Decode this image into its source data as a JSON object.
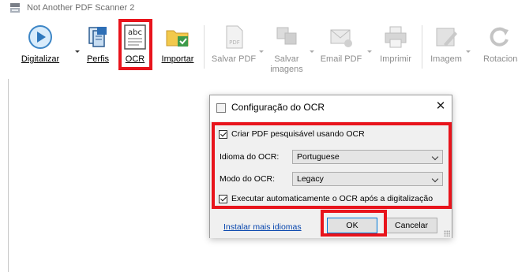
{
  "window": {
    "title": "Not Another PDF Scanner 2",
    "icon": "scanner-app-icon"
  },
  "toolbar": {
    "items": [
      {
        "label": "Digitalizar",
        "icon": "scan-play-icon",
        "enabled": true,
        "dropdown": true
      },
      {
        "label": "Perfis",
        "icon": "profiles-icon",
        "enabled": true,
        "dropdown": false
      },
      {
        "label": "OCR",
        "icon": "ocr-abc-icon",
        "enabled": true,
        "dropdown": false
      },
      {
        "label": "Importar",
        "icon": "import-folder-icon",
        "enabled": true,
        "dropdown": false
      },
      {
        "label": "Salvar PDF",
        "icon": "pdf-file-icon",
        "enabled": false,
        "dropdown": true
      },
      {
        "label": "Salvar imagens",
        "icon": "save-images-icon",
        "enabled": false,
        "dropdown": true
      },
      {
        "label": "Email PDF",
        "icon": "email-pdf-icon",
        "enabled": false,
        "dropdown": true
      },
      {
        "label": "Imprimir",
        "icon": "printer-icon",
        "enabled": false,
        "dropdown": false
      },
      {
        "label": "Imagem",
        "icon": "image-edit-icon",
        "enabled": false,
        "dropdown": true
      },
      {
        "label": "Rotacionar",
        "icon": "rotate-icon",
        "enabled": false,
        "dropdown": false
      }
    ]
  },
  "dialog": {
    "title": "Configuração do OCR",
    "enable_ocr": {
      "label": "Criar PDF pesquisável usando OCR",
      "checked": true
    },
    "language": {
      "label": "Idioma do OCR:",
      "value": "Portuguese"
    },
    "mode": {
      "label": "Modo do OCR:",
      "value": "Legacy"
    },
    "auto_run": {
      "label": "Executar automaticamente o OCR após a digitalização",
      "checked": true
    },
    "more_languages_link": "Instalar mais idiomas",
    "ok_label": "OK",
    "cancel_label": "Cancelar"
  },
  "colors": {
    "highlight_red": "#e8141c",
    "link_blue": "#0645ad",
    "dialog_body": "#f0f0f0"
  }
}
